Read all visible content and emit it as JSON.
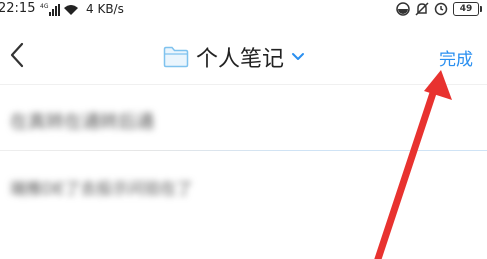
{
  "status_bar": {
    "time": "22:15",
    "network_label": "4G",
    "speed": "4 KB/s",
    "battery": "49"
  },
  "header": {
    "title": "个人笔记",
    "done_label": "完成"
  },
  "notes": [
    {
      "preview": "在真转在通转后通"
    },
    {
      "preview": "端推DE了去投示问验在了"
    }
  ],
  "colors": {
    "accent": "#2a8ff0",
    "annotation_arrow": "#e8322f",
    "folder_icon": "#7fc2ee"
  }
}
